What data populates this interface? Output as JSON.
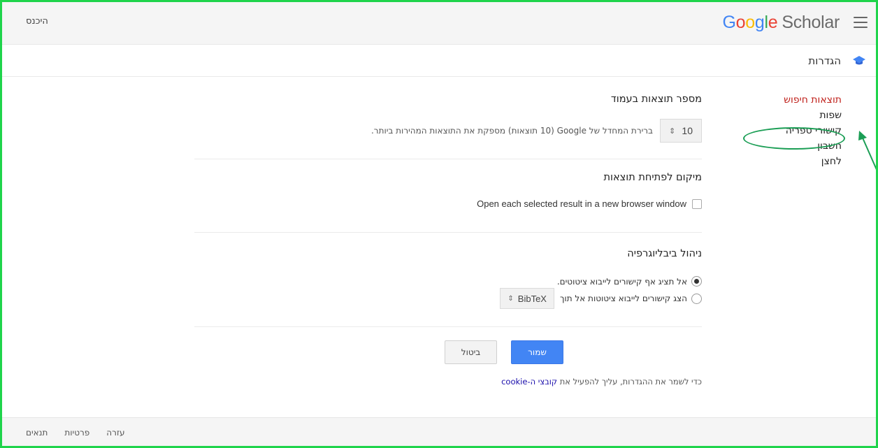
{
  "header": {
    "logo": {
      "g1": "G",
      "o1": "o",
      "o2": "o",
      "g2": "g",
      "l": "l",
      "e": "e",
      "scholar": "Scholar"
    },
    "signin_label": "היכנס",
    "menu_icon": "hamburger-menu-icon"
  },
  "settings": {
    "title": "הגדרות",
    "icon": "graduation-cap-icon"
  },
  "sidenav": {
    "items": [
      {
        "label": "תוצאות חיפוש",
        "active": true
      },
      {
        "label": "שפות"
      },
      {
        "label": "קישורי ספריה"
      },
      {
        "label": "חשבון"
      },
      {
        "label": "לחצן"
      }
    ]
  },
  "sections": {
    "results_per_page": {
      "title": "מספר תוצאות בעמוד",
      "value": "10",
      "help": "ברירת המחדל של Google (10 תוצאות) מספקת את התוצאות המהירות ביותר."
    },
    "open_results": {
      "title": "מיקום לפתיחת תוצאות",
      "checkbox_label": "Open each selected result in a new browser window",
      "checked": false
    },
    "bibliography": {
      "title": "ניהול ביבליוגרפיה",
      "option1": "אל תציג אף קישורים לייבוא ציטוטים.",
      "option2": "הצג קישורים לייבוא ציטוטות אל תוך",
      "format": "BibTeX",
      "selected_option": 1
    }
  },
  "actions": {
    "save": "שמור",
    "cancel": "ביטול",
    "cookie_note_prefix": "כדי לשמר את ההגדרות, עליך להפעיל את ",
    "cookie_link": "קובצי ה-cookie"
  },
  "footer": {
    "links": [
      "עזרה",
      "פרטיות",
      "תנאים"
    ]
  },
  "colors": {
    "accent": "#4285f4",
    "active_nav": "#c0221c",
    "annotation": "#1b9e55",
    "frame": "#1fd44b"
  }
}
